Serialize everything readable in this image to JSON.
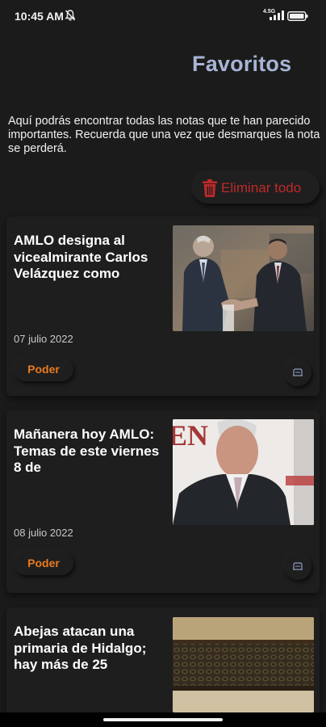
{
  "status_bar": {
    "time": "10:45 AM",
    "network": "4.5G",
    "icons": [
      "mute-icon",
      "signal-icon",
      "battery-icon"
    ],
    "battery_level": "84"
  },
  "header": {
    "title": "Favoritos",
    "description": "Aquí podrás encontrar todas las notas que te han parecido importantes. Recuerda que una vez que desmarques la nota se perderá."
  },
  "actions": {
    "delete_all_label": "Eliminar todo",
    "delete_all_icon": "trash-icon"
  },
  "articles": [
    {
      "title": "AMLO designa al vicealmirante Carlos Velázquez como",
      "date": "07 julio 2022",
      "category": "Poder",
      "image": "two men shaking hands"
    },
    {
      "title": "Mañanera hoy AMLO: Temas de este viernes 8 de",
      "date": "08 julio 2022",
      "category": "Poder",
      "image": "man at press conference"
    },
    {
      "title": "Abejas atacan una primaria de Hidalgo; hay más de 25",
      "date": "",
      "category": "",
      "image": "bees inside a hive"
    }
  ],
  "colors": {
    "background": "#1b1b1b",
    "card": "#1e1e1e",
    "title": "#a6b4d6",
    "danger": "#c02a2a",
    "category": "#ea7a1e"
  }
}
